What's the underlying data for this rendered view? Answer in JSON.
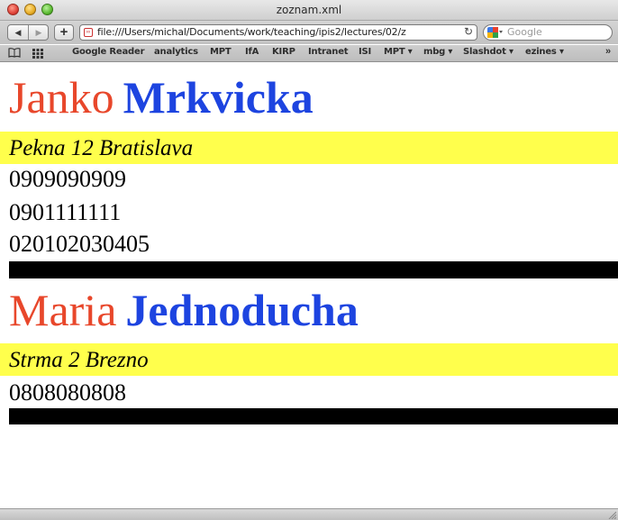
{
  "window": {
    "title": "zoznam.xml"
  },
  "toolbar": {
    "back_icon": "back-arrow-icon",
    "forward_icon": "forward-arrow-icon",
    "add_icon": "plus-icon",
    "url": "file:///Users/michal/Documents/work/teaching/ipis2/lectures/02/z",
    "reload_icon": "reload-icon",
    "search_placeholder": "Google"
  },
  "bookmarks": {
    "items": [
      {
        "label": "Google Reader"
      },
      {
        "label": "analytics"
      },
      {
        "label": "MPT"
      },
      {
        "label": "IfA"
      },
      {
        "label": "KIRP"
      },
      {
        "label": "Intranet"
      },
      {
        "label": "ISI"
      },
      {
        "label": "MPT ▾"
      },
      {
        "label": "mbg ▾"
      },
      {
        "label": "Slashdot ▾"
      },
      {
        "label": "ezines ▾"
      }
    ],
    "more": "»"
  },
  "contacts": [
    {
      "first_name": "Janko",
      "last_name": "Mrkvicka",
      "address": "Pekna 12 Bratislava",
      "phones": [
        "0909090909",
        "0901111111",
        "020102030405"
      ]
    },
    {
      "first_name": "Maria",
      "last_name": "Jednoducha",
      "address": "Strma 2 Brezno",
      "phones": [
        "0808080808"
      ]
    }
  ],
  "colors": {
    "first_name": "#e8472b",
    "last_name": "#1d44e0",
    "address_bg": "#ffff4c",
    "separator": "#000000"
  }
}
